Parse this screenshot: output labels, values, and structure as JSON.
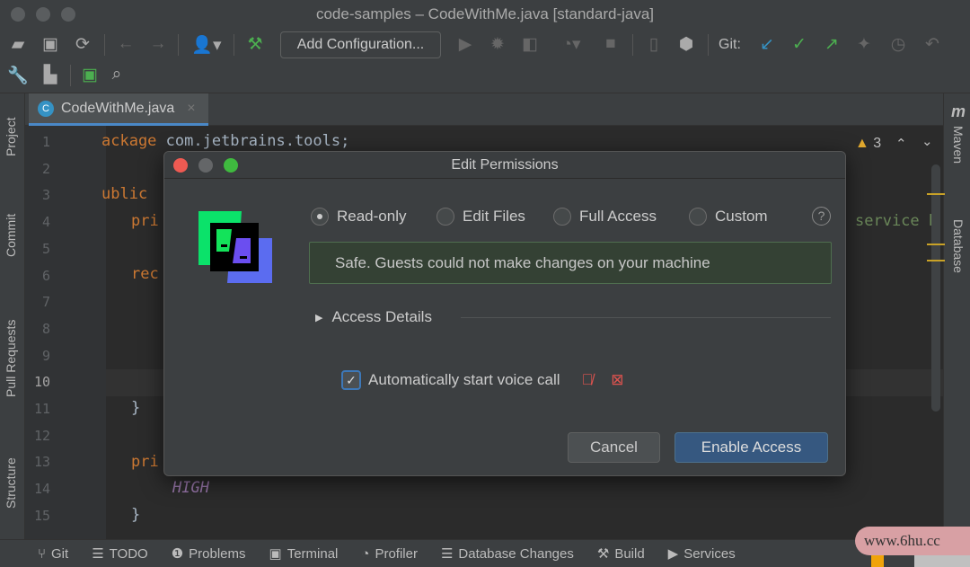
{
  "window": {
    "title": "code-samples – CodeWithMe.java [standard-java]"
  },
  "toolbar": {
    "add_configuration": "Add Configuration...",
    "git_label": "Git:",
    "icons": [
      "open-folder",
      "save",
      "sync",
      "back",
      "forward",
      "user-access",
      "build-hammer",
      "run",
      "debug",
      "coverage",
      "profile",
      "stop",
      "device",
      "deploy",
      "git-update",
      "git-commit",
      "git-push",
      "git-merge",
      "git-history",
      "git-rollback",
      "wrench",
      "project-structure",
      "terminal-run",
      "search"
    ]
  },
  "left_tools": [
    "Project",
    "Commit",
    "Pull Requests",
    "Structure"
  ],
  "right_tools": [
    "Maven",
    "Database"
  ],
  "editor": {
    "tab": "CodeWithMe.java",
    "warnings": "3",
    "line_numbers": [
      "1",
      "2",
      "3",
      "4",
      "5",
      "6",
      "7",
      "8",
      "9",
      "10",
      "11",
      "12",
      "13",
      "14",
      "15"
    ],
    "code": {
      "l1a": "ackage",
      "l1b": " com.jetbrains.tools;",
      "l3": "ublic",
      "l4": "pri",
      "l4b": "service b",
      "l6": "rec",
      "l11": "}",
      "l13": "pri",
      "l14": "HIGH",
      "l15": "}"
    }
  },
  "dialog": {
    "title": "Edit Permissions",
    "options": [
      {
        "label": "Read-only",
        "selected": true
      },
      {
        "label": "Edit Files",
        "selected": false
      },
      {
        "label": "Full Access",
        "selected": false
      },
      {
        "label": "Custom",
        "selected": false
      }
    ],
    "help": "?",
    "description": "Safe. Guests could not make changes on your machine",
    "access_details": "Access Details",
    "voice_call": {
      "label": "Automatically start voice call",
      "checked": true
    },
    "cancel": "Cancel",
    "enable": "Enable Access"
  },
  "statusbar": {
    "items": [
      "Git",
      "TODO",
      "Problems",
      "Terminal",
      "Profiler",
      "Database Changes",
      "Build",
      "Services"
    ]
  },
  "watermark": "www.6hu.cc",
  "colors": {
    "accent": "#365880",
    "success_bg": "#344134",
    "keyword": "#cc7832",
    "muted_red": "#e0534f"
  }
}
